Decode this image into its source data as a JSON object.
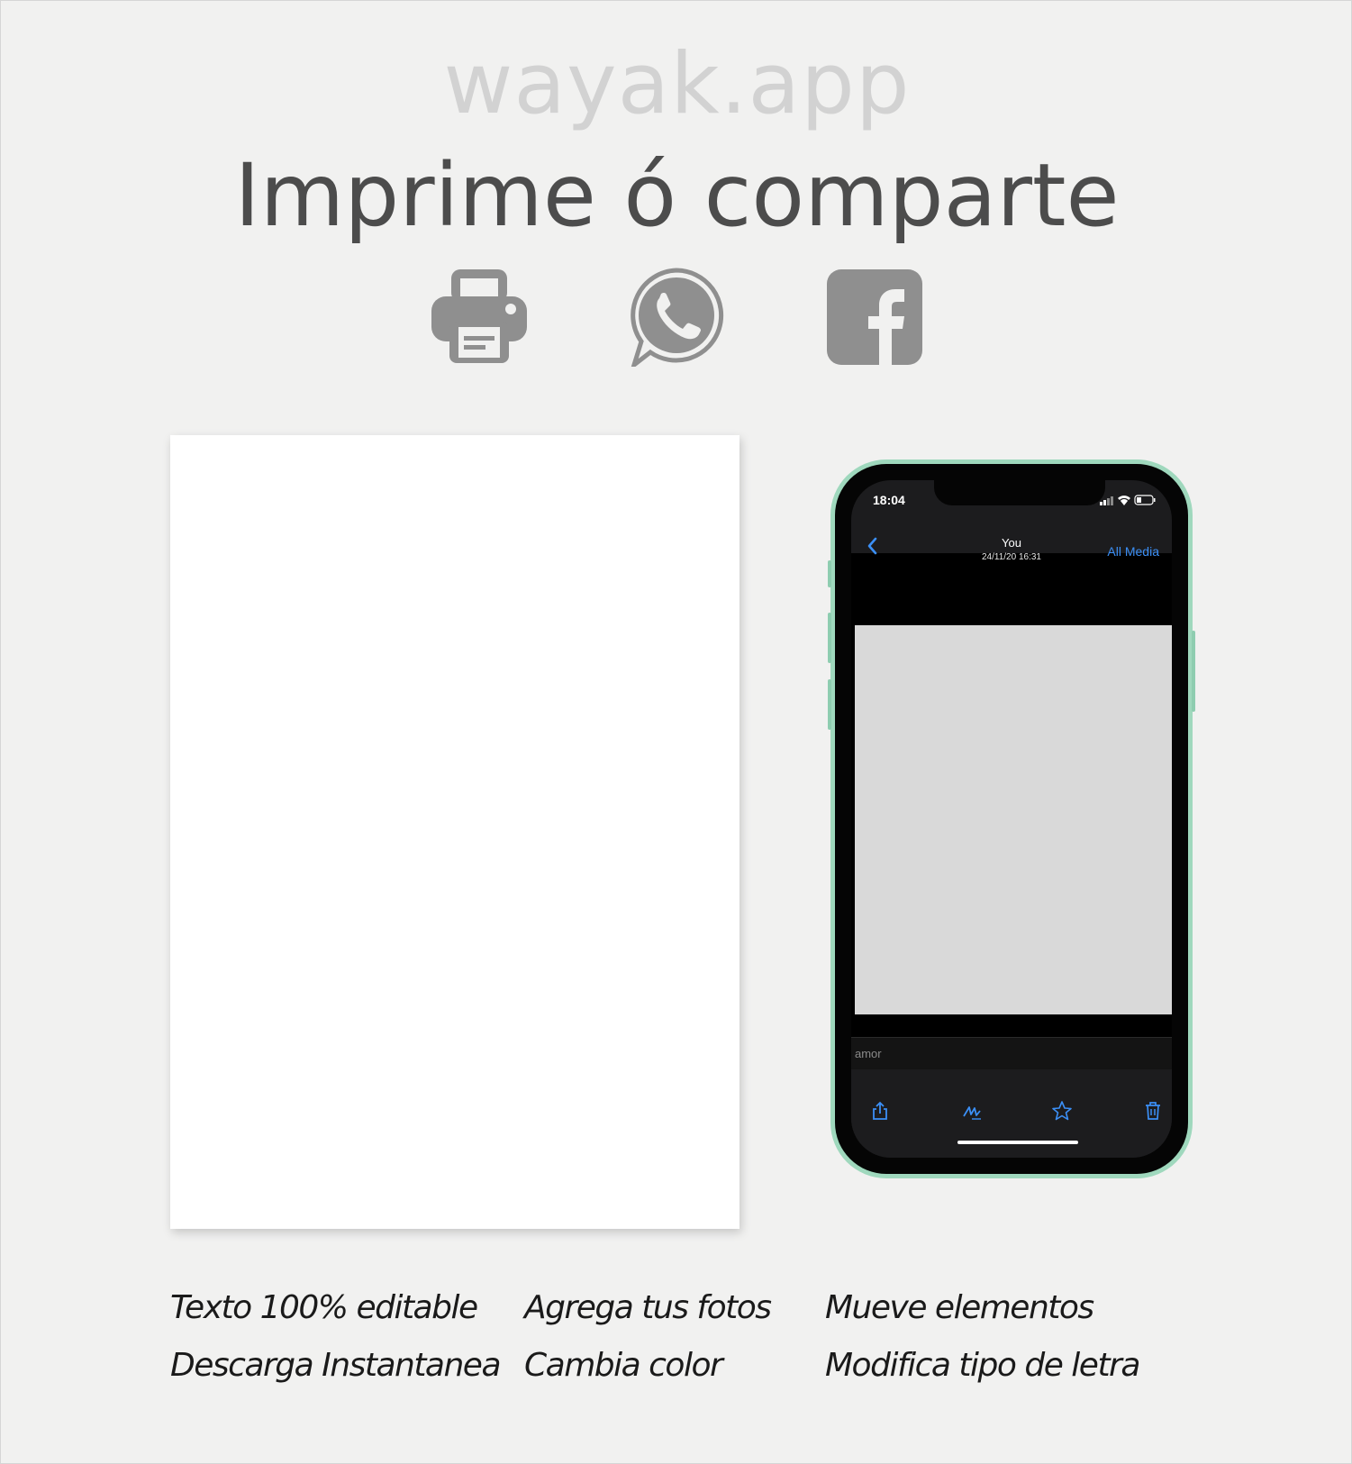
{
  "brand": "wayak.app",
  "headline": "Imprime ó comparte",
  "share_icons": [
    "printer-icon",
    "whatsapp-icon",
    "facebook-icon"
  ],
  "colors": {
    "background": "#f1f1f0",
    "icon_gray": "#8f8f8f",
    "phone_frame": "#9fd8bd",
    "ios_accent": "#3b8ff6"
  },
  "phone": {
    "status_time": "18:04",
    "nav": {
      "title": "You",
      "subtitle": "24/11/20 16:31",
      "all_media": "All Media"
    },
    "caption": "amor",
    "toolbar_icons": [
      "share-icon",
      "draw-icon",
      "star-icon",
      "trash-icon"
    ]
  },
  "features": [
    [
      "Texto 100% editable",
      "Descarga Instantanea"
    ],
    [
      "Agrega tus fotos",
      "Cambia color"
    ],
    [
      "Mueve elementos",
      "Modifica tipo de letra"
    ]
  ]
}
